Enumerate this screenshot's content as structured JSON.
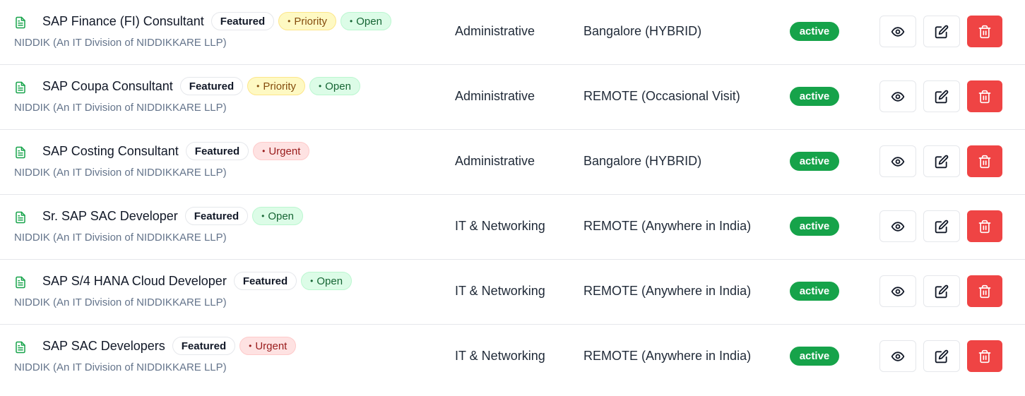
{
  "jobs": [
    {
      "title": "SAP Finance (FI) Consultant",
      "company": "NIDDIK (An IT Division of NIDDIKKARE LLP)",
      "featured": "Featured",
      "tags": [
        {
          "kind": "priority",
          "label": "Priority"
        },
        {
          "kind": "open",
          "label": "Open"
        }
      ],
      "category": "Administrative",
      "location": "Bangalore (HYBRID)",
      "status": "active"
    },
    {
      "title": "SAP Coupa Consultant",
      "company": "NIDDIK (An IT Division of NIDDIKKARE LLP)",
      "featured": "Featured",
      "tags": [
        {
          "kind": "priority",
          "label": "Priority"
        },
        {
          "kind": "open",
          "label": "Open"
        }
      ],
      "category": "Administrative",
      "location": "REMOTE (Occasional Visit)",
      "status": "active"
    },
    {
      "title": "SAP Costing Consultant",
      "company": "NIDDIK (An IT Division of NIDDIKKARE LLP)",
      "featured": "Featured",
      "tags": [
        {
          "kind": "urgent",
          "label": "Urgent"
        }
      ],
      "category": "Administrative",
      "location": "Bangalore (HYBRID)",
      "status": "active"
    },
    {
      "title": "Sr. SAP SAC Developer",
      "company": "NIDDIK (An IT Division of NIDDIKKARE LLP)",
      "featured": "Featured",
      "tags": [
        {
          "kind": "open",
          "label": "Open"
        }
      ],
      "category": "IT & Networking",
      "location": "REMOTE (Anywhere in India)",
      "status": "active"
    },
    {
      "title": "SAP S/4 HANA Cloud Developer",
      "company": "NIDDIK (An IT Division of NIDDIKKARE LLP)",
      "featured": "Featured",
      "tags": [
        {
          "kind": "open",
          "label": "Open"
        }
      ],
      "category": "IT & Networking",
      "location": "REMOTE (Anywhere in India)",
      "status": "active"
    },
    {
      "title": "SAP SAC Developers",
      "company": "NIDDIK (An IT Division of NIDDIKKARE LLP)",
      "featured": "Featured",
      "tags": [
        {
          "kind": "urgent",
          "label": "Urgent"
        }
      ],
      "category": "IT & Networking",
      "location": "REMOTE (Anywhere in India)",
      "status": "active"
    }
  ],
  "colors": {
    "status_active": "#16a34a",
    "delete_button": "#ef4444",
    "doc_icon": "#16a34a"
  },
  "icons": {
    "row": "document-icon",
    "view": "eye-icon",
    "edit": "edit-icon",
    "delete": "trash-icon"
  }
}
